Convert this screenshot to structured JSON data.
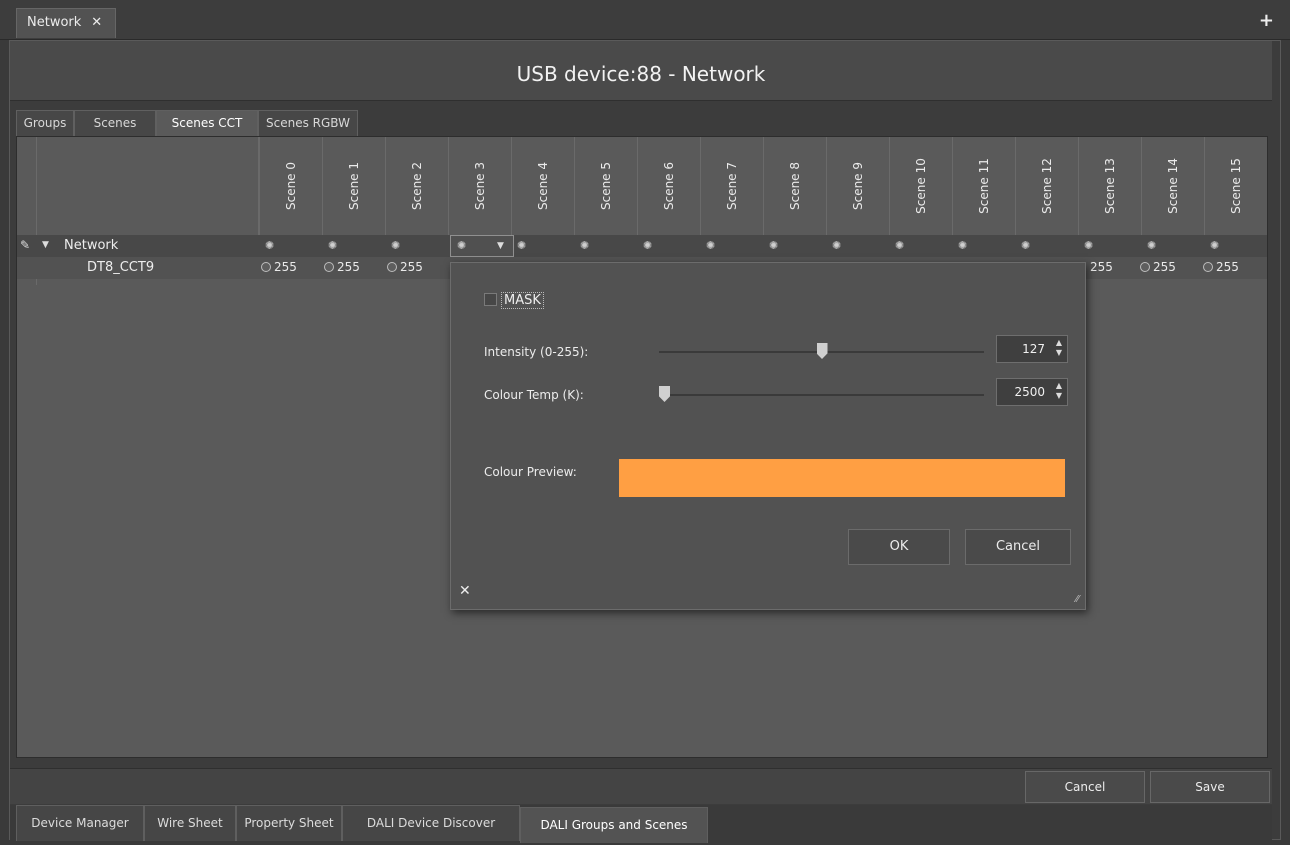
{
  "window_tab": {
    "label": "Network",
    "close_glyph": "✕"
  },
  "add_tab_glyph": "+",
  "title": "USB device:88 - Network",
  "sub_tabs": [
    {
      "label": "Groups",
      "active": false
    },
    {
      "label": "Scenes",
      "active": false
    },
    {
      "label": "Scenes CCT",
      "active": true
    },
    {
      "label": "Scenes RGBW",
      "active": false
    }
  ],
  "scene_columns": [
    "Scene 0",
    "Scene 1",
    "Scene 2",
    "Scene 3",
    "Scene 4",
    "Scene 5",
    "Scene 6",
    "Scene 7",
    "Scene 8",
    "Scene 9",
    "Scene 10",
    "Scene 11",
    "Scene 12",
    "Scene 13",
    "Scene 14",
    "Scene 15"
  ],
  "rows": {
    "network": {
      "label": "Network"
    },
    "device": {
      "label": "DT8_CCT9",
      "values_visible_left": [
        "255",
        "255",
        "255"
      ],
      "values_visible_right": [
        "255",
        "255",
        "255"
      ]
    }
  },
  "popup": {
    "mask_label": "MASK",
    "intensity_label": "Intensity (0-255):",
    "intensity_value": "127",
    "intensity_level": 0.5,
    "colour_temp_label": "Colour Temp (K):",
    "colour_temp_value": "2500",
    "colour_temp_level": 0.0,
    "preview_label": "Colour Preview:",
    "preview_color": "#ff9f43",
    "ok_label": "OK",
    "cancel_label": "Cancel",
    "close_glyph": "✕"
  },
  "footer": {
    "cancel_label": "Cancel",
    "save_label": "Save"
  },
  "bottom_tabs": [
    {
      "label": "Device Manager",
      "active": false
    },
    {
      "label": "Wire Sheet",
      "active": false
    },
    {
      "label": "Property Sheet",
      "active": false
    },
    {
      "label": "DALI Device Discover",
      "active": false
    },
    {
      "label": "DALI Groups and Scenes",
      "active": true
    }
  ],
  "icons": {
    "gear": "gear-icon",
    "radio": "radio-icon",
    "pencil": "pencil-icon"
  }
}
